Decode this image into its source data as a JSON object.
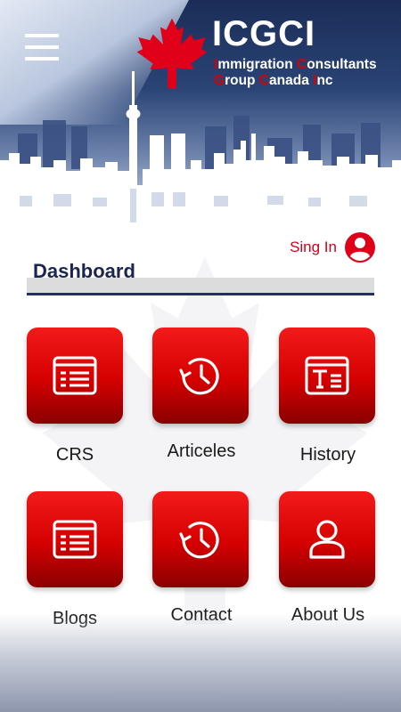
{
  "header": {
    "brand_title": "ICGCI",
    "brand_line1": [
      {
        "initial": "I",
        "rest": "mmigration "
      },
      {
        "initial": "C",
        "rest": "onsultants"
      }
    ],
    "brand_line2": [
      {
        "initial": "G",
        "rest": "roup "
      },
      {
        "initial": "C",
        "rest": "anada "
      },
      {
        "initial": "I",
        "rest": "nc"
      }
    ],
    "menu_icon": "hamburger-menu-icon",
    "logo_icon": "maple-leaf-icon"
  },
  "auth": {
    "signin_label": "Sing In",
    "signin_icon": "user-circle-icon"
  },
  "dashboard": {
    "title": "Dashboard",
    "tiles": [
      {
        "label": "CRS",
        "icon": "document-list-icon"
      },
      {
        "label": "Articeles",
        "icon": "history-clock-icon"
      },
      {
        "label": "History",
        "icon": "text-document-icon"
      },
      {
        "label": "Blogs",
        "icon": "document-list-icon"
      },
      {
        "label": "Contact",
        "icon": "history-clock-icon"
      },
      {
        "label": "About Us",
        "icon": "user-icon"
      }
    ]
  },
  "colors": {
    "accent_red": "#d40000",
    "navy": "#1b2d57",
    "dashboard_text": "#1b2550"
  }
}
